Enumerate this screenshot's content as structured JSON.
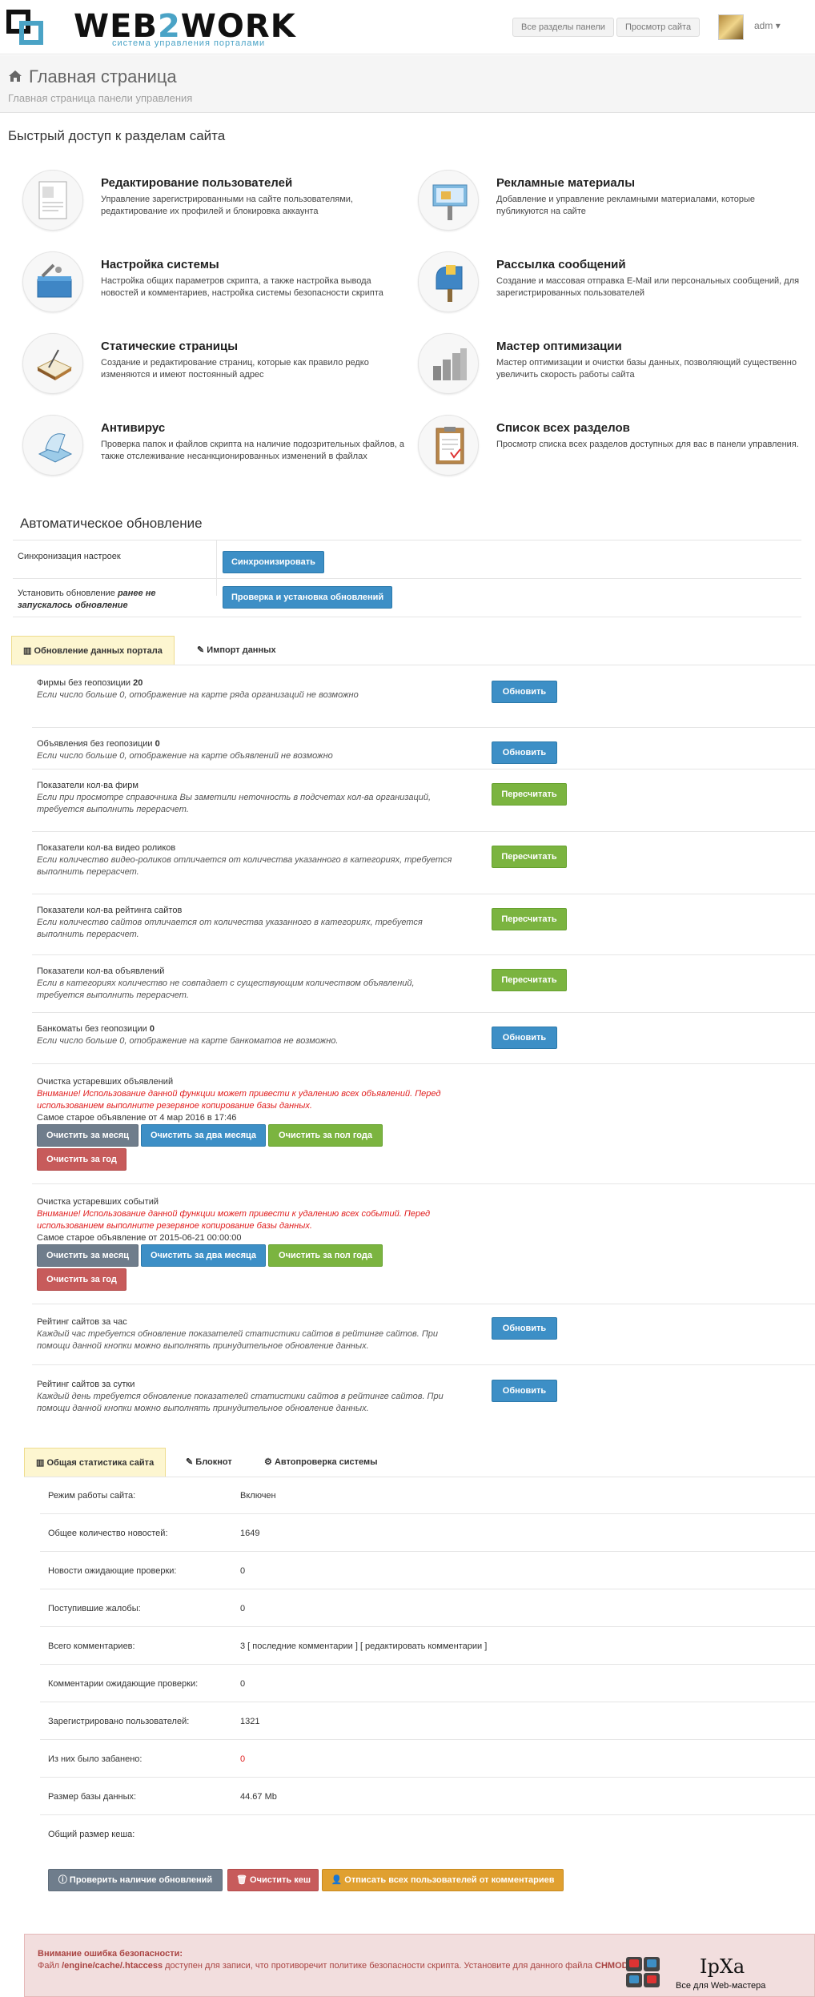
{
  "header": {
    "logo_text_a": "WEB",
    "logo_text_b": "2",
    "logo_text_c": "WORK",
    "logo_sub": "система управления порталами",
    "btn_all_sections": "Все разделы панели",
    "btn_view_site": "Просмотр сайта",
    "user": "adm"
  },
  "page": {
    "title": "Главная страница",
    "subtitle": "Главная страница панели управления"
  },
  "quick": {
    "heading": "Быстрый доступ к разделам сайта",
    "items": [
      {
        "title": "Редактирование пользователей",
        "desc": "Управление зарегистрированными на сайте пользователями, редактирование их профилей и блокировка аккаунта"
      },
      {
        "title": "Рекламные материалы",
        "desc": "Добавление и управление рекламными материалами, которые публикуются на сайте"
      },
      {
        "title": "Настройка системы",
        "desc": "Настройка общих параметров скрипта, а также настройка вывода новостей и комментариев, настройка системы безопасности скрипта"
      },
      {
        "title": "Рассылка сообщений",
        "desc": "Создание и массовая отправка E-Mail или персональных сообщений, для зарегистрированных пользователей"
      },
      {
        "title": "Статические страницы",
        "desc": "Создание и редактирование страниц, которые как правило редко изменяются и имеют постоянный адрес"
      },
      {
        "title": "Мастер оптимизации",
        "desc": "Мастер оптимизации и очистки базы данных, позволяющий существенно увеличить скорость работы сайта"
      },
      {
        "title": "Антивирус",
        "desc": "Проверка папок и файлов скрипта на наличие подозрительных файлов, а также отслеживание несанкционированных изменений в файлах"
      },
      {
        "title": "Список всех разделов",
        "desc": "Просмотр списка всех разделов доступных для вас в панели управления."
      }
    ]
  },
  "autoupdate": {
    "heading": "Автоматическое обновление",
    "sync_label": "Синхронизация настроек",
    "sync_btn": "Синхронизировать",
    "install_label_a": "Установить обновление",
    "install_label_b": "ранее не запускалось обновление",
    "install_btn": "Проверка и установка обновлений"
  },
  "tabs1": {
    "active": "Обновление данных портала",
    "other": "Импорт данных"
  },
  "portal_rows": [
    {
      "label": "Фирмы без геопозиции",
      "count": "20",
      "note": "Если число больше 0, отображение на карте ряда организаций не возможно",
      "btn": "Обновить",
      "color": "blue"
    },
    {
      "label": "Объявления без геопозиции",
      "count": "0",
      "note": "Если число больше 0, отображение на карте объявлений не возможно",
      "btn": "Обновить",
      "color": "blue"
    },
    {
      "label": "Показатели кол-ва фирм",
      "count": "",
      "note": "Если при просмотре справочника Вы заметили неточность в подсчетах кол-ва организаций, требуется выполнить перерасчет.",
      "btn": "Пересчитать",
      "color": "green"
    },
    {
      "label": "Показатели кол-ва видео роликов",
      "count": "",
      "note": "Если количество видео-роликов отличается от количества указанного в категориях, требуется выполнить перерасчет.",
      "btn": "Пересчитать",
      "color": "green"
    },
    {
      "label": "Показатели кол-ва рейтинга сайтов",
      "count": "",
      "note": "Если количество сайтов отличается от количества указанного в категориях, требуется выполнить перерасчет.",
      "btn": "Пересчитать",
      "color": "green"
    },
    {
      "label": "Показатели кол-ва объявлений",
      "count": "",
      "note": "Если в категориях количество не совпадает с существующим количеством объявлений, требуется выполнить перерасчет.",
      "btn": "Пересчитать",
      "color": "green"
    },
    {
      "label": "Банкоматы без геопозиции",
      "count": "0",
      "note": "Если число больше 0, отображение на карте банкоматов не возможно.",
      "btn": "Обновить",
      "color": "blue"
    }
  ],
  "cleanup_ads": {
    "label": "Очистка устаревших объявлений",
    "warn": "Внимание! Использование данной функции может привести к удалению всех объявлений. Перед использованием выполните резервное копирование базы данных.",
    "oldest": "Самое старое объявление от 4 мар 2016 в 17:46",
    "b1": "Очистить за месяц",
    "b2": "Очистить за два месяца",
    "b3": "Очистить за пол года",
    "b4": "Очистить за год"
  },
  "cleanup_events": {
    "label": "Очистка устаревших событий",
    "warn": "Внимание! Использование данной функции может привести к удалению всех событий. Перед использованием выполните резервное копирование базы данных.",
    "oldest": "Самое старое объявление от 2015-06-21 00:00:00",
    "b1": "Очистить за месяц",
    "b2": "Очистить за два месяца",
    "b3": "Очистить за пол года",
    "b4": "Очистить за год"
  },
  "rating_hour": {
    "label": "Рейтинг сайтов за час",
    "note": "Каждый час требуется обновление показателей статистики сайтов в рейтинге сайтов. При помощи данной кнопки можно выполнять принудительное обновление данных.",
    "btn": "Обновить"
  },
  "rating_day": {
    "label": "Рейтинг сайтов за сутки",
    "note": "Каждый день требуется обновление показателей статистики сайтов в рейтинге сайтов. При помощи данной кнопки можно выполнять принудительное обновление данных.",
    "btn": "Обновить"
  },
  "tabs2": {
    "active": "Общая статистика сайта",
    "notepad": "Блокнот",
    "autocheck": "Автопроверка системы"
  },
  "stats": [
    {
      "label": "Режим работы сайта:",
      "value": "Включен"
    },
    {
      "label": "Общее количество новостей:",
      "value": "1649"
    },
    {
      "label": "Новости ожидающие проверки:",
      "value": "0"
    },
    {
      "label": "Поступившие жалобы:",
      "value": "0"
    },
    {
      "label": "Всего комментариев:",
      "value": "3 [ последние комментарии ] [ редактировать комментарии ]"
    },
    {
      "label": "Комментарии ожидающие проверки:",
      "value": "0"
    },
    {
      "label": "Зарегистрировано пользователей:",
      "value": "1321"
    },
    {
      "label": "Из них было забанено:",
      "value": "0"
    },
    {
      "label": "Размер базы данных:",
      "value": "44.67 Mb"
    },
    {
      "label": "Общий размер кеша:",
      "value": ""
    }
  ],
  "bottom_buttons": {
    "check": "Проверить наличие обновлений",
    "clear": "Очистить кеш",
    "unsub": "Отписать всех пользователей от комментариев"
  },
  "alert": {
    "title": "Внимание ошибка безопасности:",
    "text_a": "Файл ",
    "file": "/engine/cache/.htaccess",
    "text_b": " доступен для записи, что противоречит политике безопасности скрипта. Установите для данного файла ",
    "chmod": "CHMOD"
  },
  "watermark": {
    "brand": "IpXa",
    "tag": "Все для Web-мастера"
  },
  "colors": {
    "blue": "#3d8fc6",
    "green": "#7bb440",
    "gray": "#6f7d8c",
    "red": "#c75b5b",
    "orange": "#e0a030",
    "accent": "#4aa3c6",
    "warn": "#e02020"
  }
}
